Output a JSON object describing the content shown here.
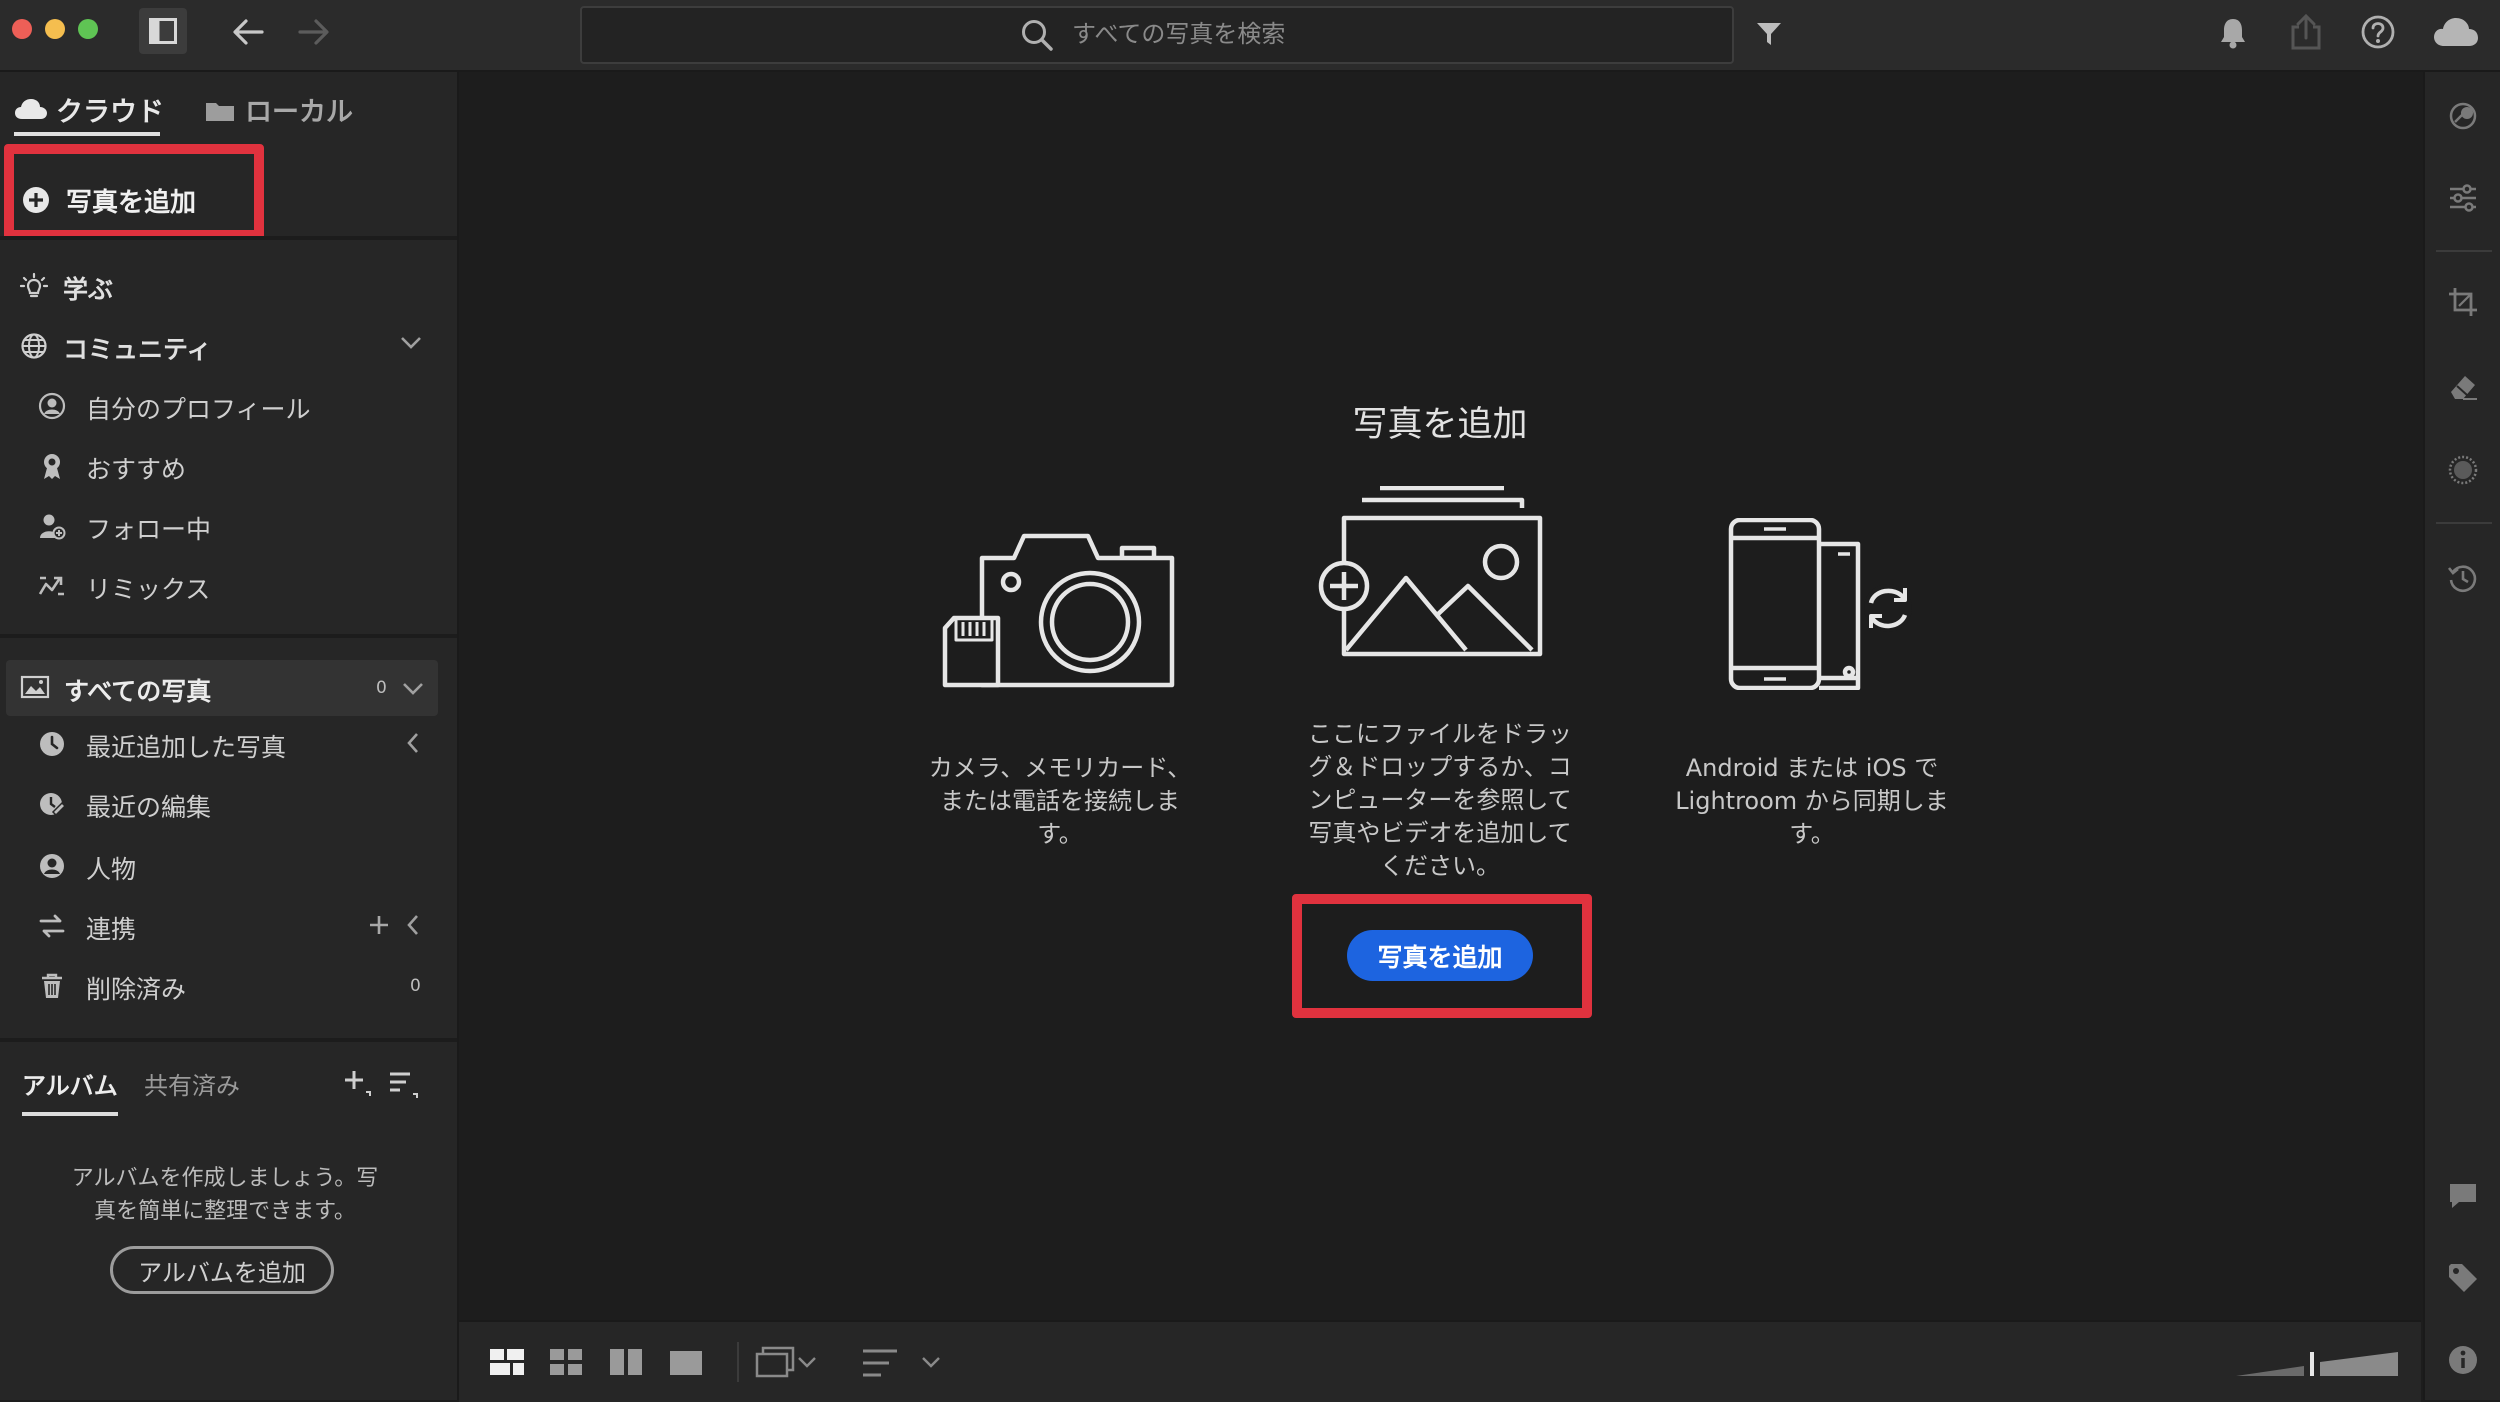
{
  "search": {
    "placeholder": "すべての写真を検索"
  },
  "sidebar": {
    "tabs": [
      {
        "label": "クラウド"
      },
      {
        "label": "ローカル"
      }
    ],
    "add_photos": "写真を追加",
    "learn": "学ぶ",
    "community": {
      "label": "コミュニティ",
      "items": [
        {
          "label": "自分のプロフィール"
        },
        {
          "label": "おすすめ"
        },
        {
          "label": "フォロー中"
        },
        {
          "label": "リミックス"
        }
      ]
    },
    "library": {
      "all_photos": {
        "label": "すべての写真",
        "count": "0"
      },
      "items": [
        {
          "label": "最近追加した写真"
        },
        {
          "label": "最近の編集"
        },
        {
          "label": "人物"
        },
        {
          "label": "連携"
        },
        {
          "label": "削除済み",
          "count": "0"
        }
      ]
    },
    "albums": {
      "tabs": [
        {
          "label": "アルバム"
        },
        {
          "label": "共有済み"
        }
      ],
      "empty_text": "アルバムを作成しましょう。写\n真を簡単に整理できます。",
      "add_button": "アルバムを追加"
    }
  },
  "main": {
    "title": "写真を追加",
    "columns": [
      {
        "icon": "camera-icon",
        "text": "カメラ、メモリカード、\nまたは電話を接続しま\nす。"
      },
      {
        "icon": "add-image-icon",
        "text": "ここにファイルをドラッ\nグ＆ドロップするか、コ\nンピューターを参照して\n写真やビデオを追加して\nください。"
      },
      {
        "icon": "phone-sync-icon",
        "text": "Android または iOS で\nLightroom から同期しま\nす。"
      }
    ],
    "add_button": "写真を追加"
  },
  "colors": {
    "accent": "#1d64e0",
    "highlight": "#e0323e",
    "background": "#1d1d1d",
    "panel": "#262626"
  }
}
